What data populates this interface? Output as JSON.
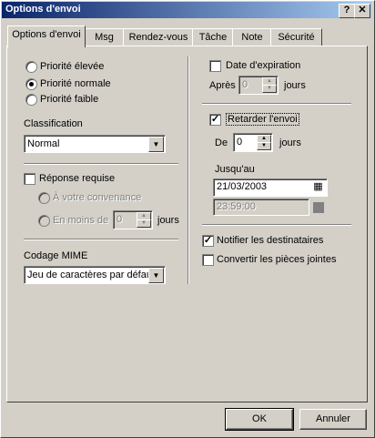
{
  "window": {
    "title": "Options d'envoi",
    "help_label": "?",
    "close_label": "✕"
  },
  "tabs": [
    "Options d'envoi",
    "Msg",
    "Rendez-vous",
    "Tâche",
    "Note",
    "Sécurité"
  ],
  "priority": {
    "options": [
      "Priorité élevée",
      "Priorité normale",
      "Priorité faible"
    ],
    "selected": "Priorité normale"
  },
  "classification": {
    "label": "Classification",
    "value": "Normal"
  },
  "reply": {
    "label": "Réponse requise",
    "checked": false,
    "option1": "À votre convenance",
    "option2": "En moins de",
    "days_value": "0",
    "days_unit": "jours"
  },
  "mime": {
    "label": "Codage MIME",
    "value": "Jeu de caractères par défaut"
  },
  "expiration": {
    "label": "Date d'expiration",
    "checked": false,
    "after_label": "Après",
    "after_value": "0",
    "unit": "jours"
  },
  "delay": {
    "label": "Retarder l'envoi",
    "checked": true,
    "from_label": "De",
    "from_value": "0",
    "unit": "jours",
    "until_label": "Jusqu'au",
    "date": "21/03/2003",
    "time": "23:59:00"
  },
  "notify": {
    "label": "Notifier les destinataires",
    "checked": true
  },
  "convert": {
    "label": "Convertir les pièces jointes",
    "checked": false
  },
  "buttons": {
    "ok": "OK",
    "cancel": "Annuler"
  },
  "icons": {
    "calendar": "calendar-icon",
    "dropdown": "chevron-down-icon",
    "spin": "spin-arrows-icon"
  }
}
